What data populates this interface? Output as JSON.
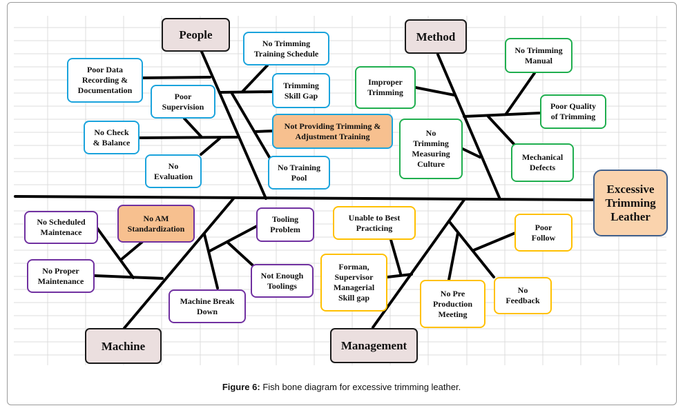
{
  "figure": {
    "caption_label": "Figure 6:",
    "caption_text": " Fish bone diagram for excessive trimming leather."
  },
  "effect": {
    "label": "Excessive\nTrimming\nLeather"
  },
  "categories": {
    "people": {
      "label": "People",
      "causes": [
        "Poor Data\nRecording &\nDocumentation",
        "No Trimming\nTraining Schedule",
        "Trimming\nSkill Gap",
        "Poor\nSupervision",
        "Not Providing  Trimming &\nAdjustment  Training",
        "No Check\n& Balance",
        "No\nEvaluation",
        "No Training\nPool"
      ]
    },
    "method": {
      "label": "Method",
      "causes": [
        "No Trimming\nManual",
        "Improper\nTrimming",
        "Poor Quality\nof Trimming",
        "No\nTrimming\nMeasuring\nCulture",
        "Mechanical\nDefects"
      ]
    },
    "machine": {
      "label": "Machine",
      "causes": [
        "No Scheduled\nMaintenace",
        "No AM\nStandardization",
        "Tooling\nProblem",
        "No Proper\nMaintenance",
        "Not Enough\nToolings",
        "Machine  Break\nDown"
      ]
    },
    "management": {
      "label": "Management",
      "causes": [
        "Unable  to Best\nPracticing",
        "Poor\nFollow",
        "Forman,\nSupervisor\nManagerial\nSkill gap",
        "No Pre\nProduction\nMeeting",
        "No\nFeedback"
      ]
    }
  },
  "colors": {
    "people": "#1aa3dc",
    "method": "#1fae4e",
    "machine": "#7030a0",
    "management": "#ffc000",
    "highlight": "#f7c08f",
    "category_fill": "#ebdfdf",
    "effect_fill": "#fad3ad",
    "effect_border": "#41608c"
  }
}
